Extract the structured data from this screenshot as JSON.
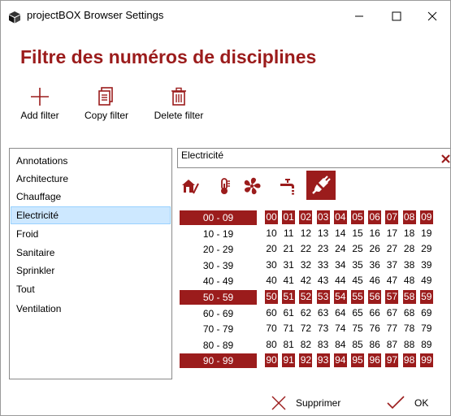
{
  "window": {
    "title": "projectBOX Browser Settings",
    "minimize_glyph": "—",
    "maximize_glyph": "☐",
    "close_glyph": "✕"
  },
  "heading": "Filtre des numéros de disciplines",
  "toolbar": {
    "add_label": "Add filter",
    "copy_label": "Copy filter",
    "delete_label": "Delete filter"
  },
  "filters": [
    {
      "label": "Annotations",
      "selected": false
    },
    {
      "label": "Architecture",
      "selected": false
    },
    {
      "label": "Chauffage",
      "selected": false
    },
    {
      "label": "Electricité",
      "selected": true
    },
    {
      "label": "Froid",
      "selected": false
    },
    {
      "label": "Sanitaire",
      "selected": false
    },
    {
      "label": "Sprinkler",
      "selected": false
    },
    {
      "label": "Tout",
      "selected": false
    },
    {
      "label": "Ventilation",
      "selected": false
    }
  ],
  "filter_name": "Electricité",
  "categories": [
    {
      "icon": "architecture-icon",
      "active": false
    },
    {
      "icon": "heating-icon",
      "active": false
    },
    {
      "icon": "ventilation-icon",
      "active": false
    },
    {
      "icon": "sanitary-icon",
      "active": false
    },
    {
      "icon": "electricity-icon",
      "active": true
    }
  ],
  "ranges": [
    {
      "label": "00 - 09",
      "selected": true
    },
    {
      "label": "10 - 19",
      "selected": false
    },
    {
      "label": "20 - 29",
      "selected": false
    },
    {
      "label": "30 - 39",
      "selected": false
    },
    {
      "label": "40 - 49",
      "selected": false
    },
    {
      "label": "50 - 59",
      "selected": true
    },
    {
      "label": "60 - 69",
      "selected": false
    },
    {
      "label": "70 - 79",
      "selected": false
    },
    {
      "label": "80 - 89",
      "selected": false
    },
    {
      "label": "90 - 99",
      "selected": true
    }
  ],
  "footer": {
    "cancel_label": "Supprimer",
    "ok_label": "OK"
  },
  "colors": {
    "accent": "#9b1c1c",
    "selection": "#cde8ff"
  }
}
